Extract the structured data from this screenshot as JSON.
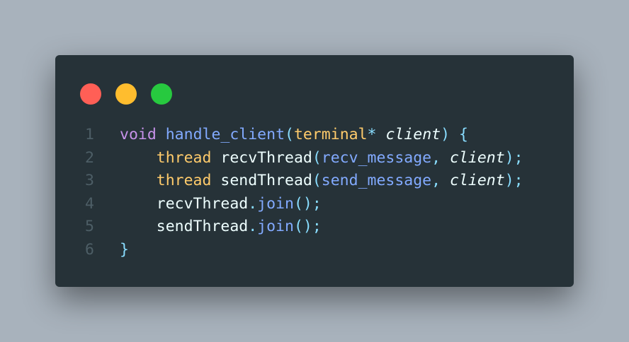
{
  "window": {
    "controls": [
      {
        "name": "close",
        "color": "#ff5f56"
      },
      {
        "name": "minimize",
        "color": "#ffbd2e"
      },
      {
        "name": "maximize",
        "color": "#27c93f"
      }
    ]
  },
  "code": {
    "lines": [
      {
        "number": "1",
        "tokens": [
          {
            "text": "void",
            "kind": "kw"
          },
          {
            "text": " ",
            "kind": "tx"
          },
          {
            "text": "handle_client",
            "kind": "fn"
          },
          {
            "text": "(",
            "kind": "pn"
          },
          {
            "text": "terminal",
            "kind": "ty"
          },
          {
            "text": "*",
            "kind": "pn"
          },
          {
            "text": " ",
            "kind": "tx"
          },
          {
            "text": "client",
            "kind": "it"
          },
          {
            "text": ")",
            "kind": "pn"
          },
          {
            "text": " ",
            "kind": "tx"
          },
          {
            "text": "{",
            "kind": "pn"
          }
        ]
      },
      {
        "number": "2",
        "tokens": [
          {
            "text": "    ",
            "kind": "tx"
          },
          {
            "text": "thread",
            "kind": "ty"
          },
          {
            "text": " recvThread",
            "kind": "tx"
          },
          {
            "text": "(",
            "kind": "pn"
          },
          {
            "text": "recv_message",
            "kind": "fn"
          },
          {
            "text": ", ",
            "kind": "pn"
          },
          {
            "text": "client",
            "kind": "it"
          },
          {
            "text": ");",
            "kind": "pn"
          }
        ]
      },
      {
        "number": "3",
        "tokens": [
          {
            "text": "    ",
            "kind": "tx"
          },
          {
            "text": "thread",
            "kind": "ty"
          },
          {
            "text": " sendThread",
            "kind": "tx"
          },
          {
            "text": "(",
            "kind": "pn"
          },
          {
            "text": "send_message",
            "kind": "fn"
          },
          {
            "text": ", ",
            "kind": "pn"
          },
          {
            "text": "client",
            "kind": "it"
          },
          {
            "text": ");",
            "kind": "pn"
          }
        ]
      },
      {
        "number": "4",
        "tokens": [
          {
            "text": "    recvThread",
            "kind": "tx"
          },
          {
            "text": ".",
            "kind": "pn"
          },
          {
            "text": "join",
            "kind": "fn"
          },
          {
            "text": "();",
            "kind": "pn"
          }
        ]
      },
      {
        "number": "5",
        "tokens": [
          {
            "text": "    sendThread",
            "kind": "tx"
          },
          {
            "text": ".",
            "kind": "pn"
          },
          {
            "text": "join",
            "kind": "fn"
          },
          {
            "text": "();",
            "kind": "pn"
          }
        ]
      },
      {
        "number": "6",
        "tokens": [
          {
            "text": "}",
            "kind": "pn"
          }
        ]
      }
    ]
  }
}
